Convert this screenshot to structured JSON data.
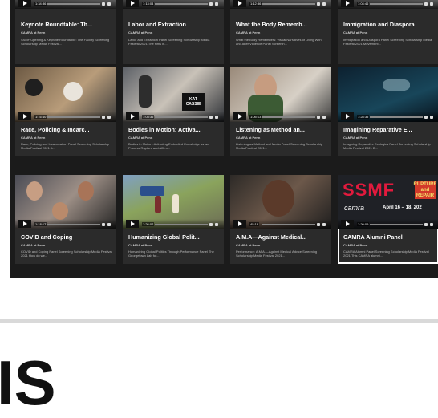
{
  "cards": [
    {
      "title": "",
      "author": "",
      "desc": "",
      "time": "1:34:36"
    },
    {
      "title": "",
      "author": "",
      "desc": "",
      "time": "1:13:04"
    },
    {
      "title": "",
      "author": "",
      "desc": "",
      "time": "1:12:36"
    },
    {
      "title": "",
      "author": "",
      "desc": "",
      "time": "1:04:46"
    },
    {
      "title": "Keynote Roundtable: Th...",
      "author": "CAMRA at Penn",
      "desc": "SSMF Opening & Keynote Roundtable: The Facility Screening Scholarship Media Festival..."
    },
    {
      "title": "Labor and Extraction",
      "author": "CAMRA at Penn",
      "desc": "Labor and Extraction Panel Screening Scholarship Media Festival 2021 The films in..."
    },
    {
      "title": "What the Body Rememb...",
      "author": "CAMRA at Penn",
      "desc": "What the Body Remembers: Visual Narratives of Living With and After Violence Panel Screenin..."
    },
    {
      "title": "Immigration and Diaspora",
      "author": "CAMRA at Penn",
      "desc": "Immigration and Diaspora Panel Screening Scholarship Media Festival 2021 Movement..."
    },
    {
      "title": "Race, Policing & Incarc...",
      "author": "CAMRA at Penn",
      "desc": "Race, Policing and Incarceration Panel Screening Scholarship Media Festival 2021 A...",
      "time": "1:16:40"
    },
    {
      "title": "Bodies in Motion: Activa...",
      "author": "CAMRA at Penn",
      "desc": "Bodies in Motion: Activating Embodied Knowledge as we Process Rupture and Affirm...",
      "time": "1:03:36",
      "badge_line1": "KAT",
      "badge_line2": "CASSIE"
    },
    {
      "title": "Listening as Method an...",
      "author": "CAMRA at Penn",
      "desc": "Listening as Method and Media Panel Screening Scholarship Media Festival 2021...",
      "time": "1:05:13"
    },
    {
      "title": "Imagining Reparative E...",
      "author": "CAMRA at Penn",
      "desc": "Imagining Reparative Ecologies Panel Screening Scholarship Media Festival 2021 B...",
      "time": "1:28:35"
    },
    {
      "title": "COVID and Coping",
      "author": "CAMRA at Penn",
      "desc": "COVID and Coping Panel Screening Scholarship Media Festival 2021 How do we...",
      "time": "1:18:17"
    },
    {
      "title": "Humanizing Global Polit...",
      "author": "CAMRA at Penn",
      "desc": "Humanizing Global Politics Through Performance Panel The Georgetown Lab for...",
      "time": "1:26:02"
    },
    {
      "title": "A.M.A—Against Medical...",
      "author": "CAMRA at Penn",
      "desc": "Performance: A.M.A.—Against Medical Advice Screening Scholarship Media Festival 2021...",
      "time": "45:19"
    },
    {
      "title": "CAMRA Alumni Panel",
      "author": "CAMRA at Penn",
      "desc": "CAMRA Alumni Panel Screening Scholarship Media Festival 2021 This CAMRA alumni...",
      "time": "1:20:09",
      "poster_title": "SSMF",
      "poster_badge_1": "RUPTURE",
      "poster_badge_2": "and",
      "poster_badge_3": "REPAIR",
      "poster_brand": "camra",
      "poster_dates": "April 16 – 18, 202"
    }
  ],
  "footer": {
    "big_text": "IS"
  }
}
